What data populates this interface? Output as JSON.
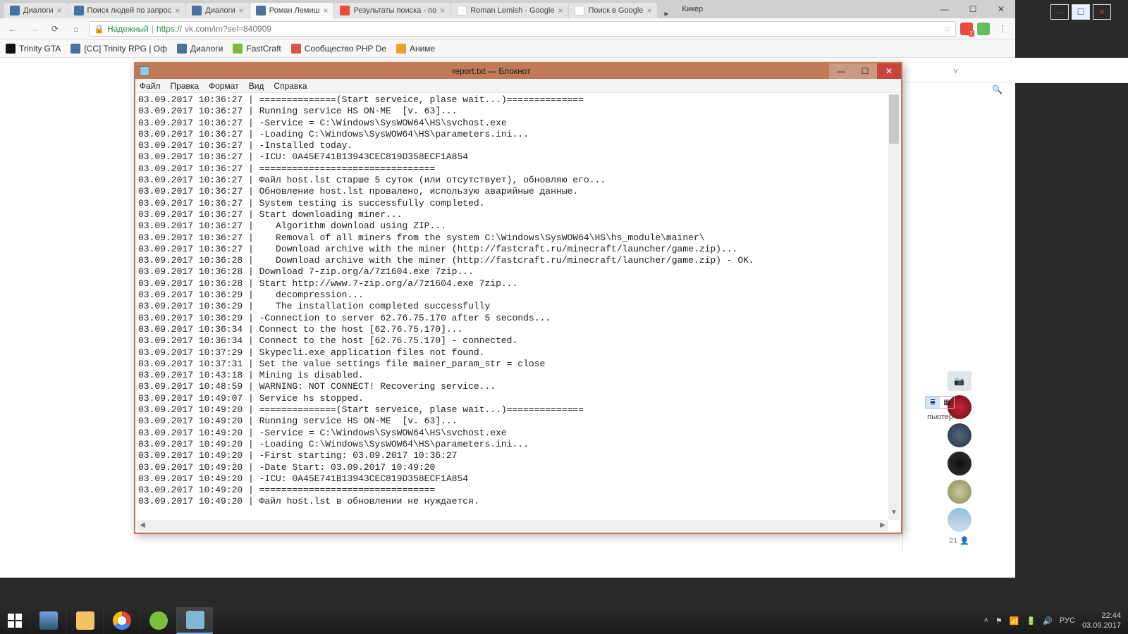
{
  "chrome": {
    "profile": "Кикер",
    "tabs": [
      {
        "label": "Диалоги",
        "favicon": "vk"
      },
      {
        "label": "Поиск людей по запрос",
        "favicon": "vk"
      },
      {
        "label": "Диалоги",
        "favicon": "vk"
      },
      {
        "label": "Роман Лемиш",
        "favicon": "vk",
        "active": true
      },
      {
        "label": "Результаты поиска - по",
        "favicon": "gmail"
      },
      {
        "label": "Roman Lemish - Google",
        "favicon": "gplus"
      },
      {
        "label": "Поиск в Google",
        "favicon": "google"
      }
    ],
    "secure_label": "Надежный",
    "url_prefix": "https://",
    "url_rest": "vk.com/im?sel=840909",
    "bookmarks": [
      {
        "label": "Trinity GTA",
        "fav": "t"
      },
      {
        "label": "[CC] Trinity RPG | Оф",
        "fav": "vk"
      },
      {
        "label": "Диалоги",
        "fav": "vk"
      },
      {
        "label": "FastCraft",
        "fav": "fast"
      },
      {
        "label": "Сообщество PHP De",
        "fav": "php"
      },
      {
        "label": "Аниме",
        "fav": "anime"
      }
    ]
  },
  "msn_window": {
    "star": "☆"
  },
  "right": {
    "label_computer": "пьютер",
    "count": "21"
  },
  "notepad": {
    "title": "report.txt — Блокнот",
    "menu": [
      "Файл",
      "Правка",
      "Формат",
      "Вид",
      "Справка"
    ],
    "lines": [
      "03.09.2017 10:36:27 | ==============(Start serveice, plase wait...)==============",
      "03.09.2017 10:36:27 | Running service HS ON-ME  [v. 63]...",
      "03.09.2017 10:36:27 | -Service = C:\\Windows\\SysWOW64\\HS\\svchost.exe",
      "03.09.2017 10:36:27 | -Loading C:\\Windows\\SysWOW64\\HS\\parameters.ini...",
      "03.09.2017 10:36:27 | -Installed today.",
      "03.09.2017 10:36:27 | -ICU: 0A45E741B13943CEC819D358ECF1A854",
      "03.09.2017 10:36:27 | ================================",
      "03.09.2017 10:36:27 | Файл host.lst старше 5 суток (или отсутствует), обновляю его...",
      "03.09.2017 10:36:27 | Обновление host.lst провалено, использую аварийные данные.",
      "03.09.2017 10:36:27 | System testing is successfully completed.",
      "03.09.2017 10:36:27 | Start downloading miner...",
      "03.09.2017 10:36:27 |    Algorithm download using ZIP...",
      "03.09.2017 10:36:27 |    Removal of all miners from the system C:\\Windows\\SysWOW64\\HS\\hs_module\\mainer\\",
      "03.09.2017 10:36:27 |    Download archive with the miner (http://fastcraft.ru/minecraft/launcher/game.zip)...",
      "03.09.2017 10:36:28 |    Download archive with the miner (http://fastcraft.ru/minecraft/launcher/game.zip) - OK.",
      "03.09.2017 10:36:28 | Download 7-zip.org/a/7z1604.exe 7zip...",
      "03.09.2017 10:36:28 | Start http://www.7-zip.org/a/7z1604.exe 7zip...",
      "03.09.2017 10:36:29 |    decompression...",
      "03.09.2017 10:36:29 |    The installation completed successfully",
      "03.09.2017 10:36:29 | -Connection to server 62.76.75.170 after 5 seconds...",
      "03.09.2017 10:36:34 | Connect to the host [62.76.75.170]...",
      "03.09.2017 10:36:34 | Connect to the host [62.76.75.170] - connected.",
      "03.09.2017 10:37:29 | Skypecli.exe application files not found.",
      "03.09.2017 10:37:31 | Set the value settings file mainer_param_str = close",
      "03.09.2017 10:43:18 | Mining is disabled.",
      "03.09.2017 10:48:59 | WARNING: NOT CONNECT! Recovering service...",
      "03.09.2017 10:49:07 | Service hs stopped.",
      "03.09.2017 10:49:20 | ==============(Start serveice, plase wait...)==============",
      "03.09.2017 10:49:20 | Running service HS ON-ME  [v. 63]...",
      "03.09.2017 10:49:20 | -Service = C:\\Windows\\SysWOW64\\HS\\svchost.exe",
      "03.09.2017 10:49:20 | -Loading C:\\Windows\\SysWOW64\\HS\\parameters.ini...",
      "03.09.2017 10:49:20 | -First starting: 03.09.2017 10:36:27",
      "03.09.2017 10:49:20 | -Date Start: 03.09.2017 10:49:20",
      "03.09.2017 10:49:20 | -ICU: 0A45E741B13943CEC819D358ECF1A854",
      "03.09.2017 10:49:20 | ================================",
      "03.09.2017 10:49:20 | Файл host.lst в обновлении не нуждается."
    ]
  },
  "taskbar": {
    "lang": "РУС",
    "time": "22:44",
    "date": "03.09.2017"
  }
}
